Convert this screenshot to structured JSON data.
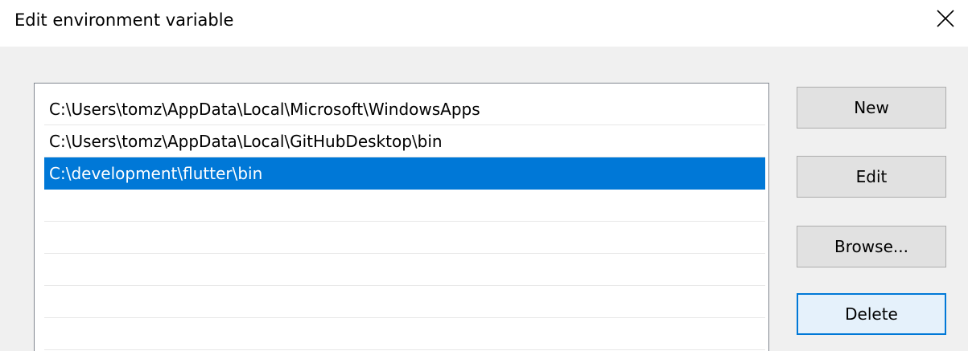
{
  "window": {
    "title": "Edit environment variable",
    "close_icon": "close-icon"
  },
  "list": {
    "items": [
      "C:\\Users\\tomz\\AppData\\Local\\Microsoft\\WindowsApps",
      "C:\\Users\\tomz\\AppData\\Local\\GitHubDesktop\\bin",
      "C:\\development\\flutter\\bin",
      "",
      "",
      "",
      "",
      ""
    ],
    "selected_index": 2
  },
  "buttons": {
    "new_label": "New",
    "edit_label": "Edit",
    "browse_label": "Browse...",
    "delete_label": "Delete"
  },
  "colors": {
    "selection": "#0078d7",
    "button_face": "#e1e1e1",
    "focus_border": "#0078d7",
    "dialog_background": "#f0f0f0"
  }
}
